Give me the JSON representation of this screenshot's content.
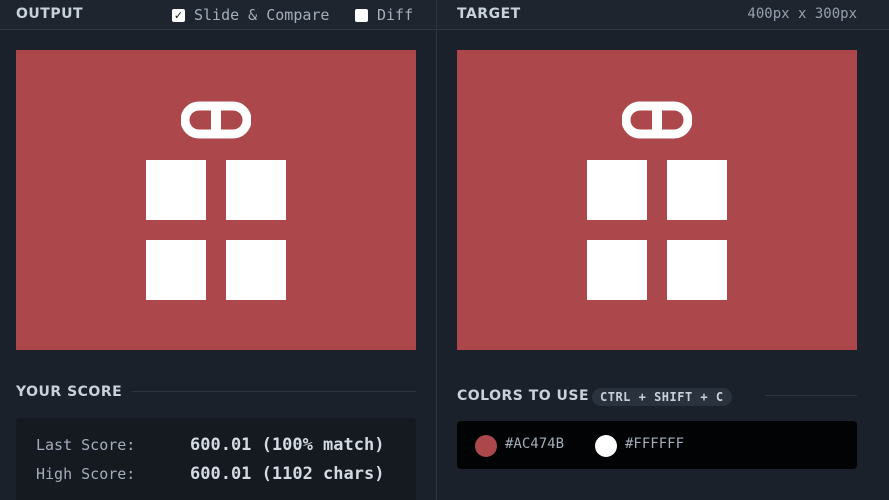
{
  "output": {
    "title": "OUTPUT",
    "slide_compare": {
      "label": "Slide & Compare",
      "checked": true
    },
    "diff": {
      "label": "Diff",
      "checked": false
    }
  },
  "target": {
    "title": "TARGET",
    "dimensions": "400px x 300px"
  },
  "score": {
    "title": "YOUR SCORE",
    "last_label": "Last Score:",
    "last_value": "600.01 (100% match)",
    "high_label": "High Score:",
    "high_value": "600.01 (1102 chars)"
  },
  "colors": {
    "title": "COLORS TO USE",
    "shortcut": "CTRL + SHIFT + C",
    "list": [
      {
        "hex": "#AC474B"
      },
      {
        "hex": "#FFFFFF"
      }
    ]
  },
  "icons": {
    "checkbox_checked": "check-icon",
    "checkbox_unchecked": "empty-box-icon"
  }
}
